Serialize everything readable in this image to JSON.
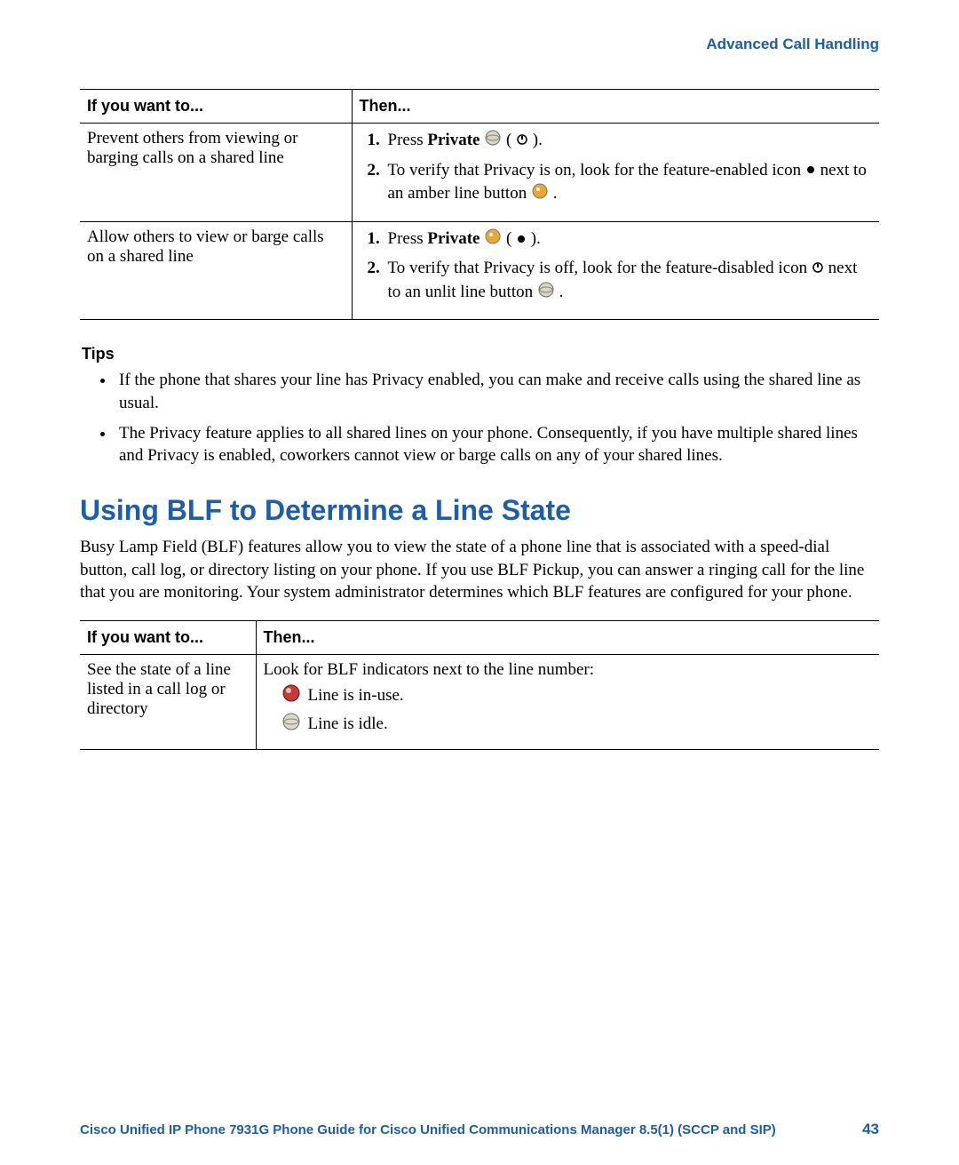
{
  "header": {
    "right_title": "Advanced Call Handling"
  },
  "table1": {
    "header_left": "If you want to...",
    "header_right": "Then...",
    "rows": [
      {
        "want": "Prevent others from viewing or barging calls on a shared line",
        "step1_a": "Press ",
        "step1_b": "Private",
        "step1_c": " ",
        "step1_d": " ( ",
        "step1_e": " ).",
        "step2_a": "To verify that Privacy is on, look for the feature-enabled icon ",
        "step2_b": " next to an amber line button ",
        "step2_c": " ."
      },
      {
        "want": "Allow others to view or barge calls on a shared line",
        "step1_a": "Press ",
        "step1_b": "Private",
        "step1_c": " ",
        "step1_d": " ( ",
        "step1_e": " ).",
        "step2_a": "To verify that Privacy is off, look for the feature-disabled icon ",
        "step2_b": " next to an unlit line button ",
        "step2_c": "."
      }
    ]
  },
  "tips": {
    "heading": "Tips",
    "items": [
      "If the phone that shares your line has Privacy enabled, you can make and receive calls using the shared line as usual.",
      "The Privacy feature applies to all shared lines on your phone. Consequently, if you have multiple shared lines and Privacy is enabled, coworkers cannot view or barge calls on any of your shared lines."
    ]
  },
  "section": {
    "title": "Using BLF to Determine a Line State",
    "body": "Busy Lamp Field (BLF) features allow you to view the state of a phone line that is associated with a speed-dial button, call log, or directory listing on your phone. If you use BLF Pickup, you can answer a ringing call for the line that you are monitoring. Your system administrator determines which BLF features are configured for your phone."
  },
  "table2": {
    "header_left": "If you want to...",
    "header_right": "Then...",
    "row": {
      "want": "See the state of a line listed in a call log or directory",
      "intro": "Look for BLF indicators next to the line number:",
      "ind1": "Line is in-use.",
      "ind2": "Line is idle."
    }
  },
  "footer": {
    "title": "Cisco Unified IP Phone 7931G Phone Guide for Cisco Unified Communications Manager 8.5(1) (SCCP and SIP)",
    "page": "43"
  },
  "icons": {
    "private_button": "private-button-icon",
    "privacy_on_small": "privacy-on-small-icon",
    "privacy_off_small": "privacy-off-small-icon",
    "feature_enabled": "feature-enabled-icon",
    "feature_disabled": "feature-disabled-icon",
    "amber_line": "amber-line-button-icon",
    "unlit_line": "unlit-line-button-icon",
    "blf_inuse": "blf-in-use-icon",
    "blf_idle": "blf-idle-icon"
  }
}
